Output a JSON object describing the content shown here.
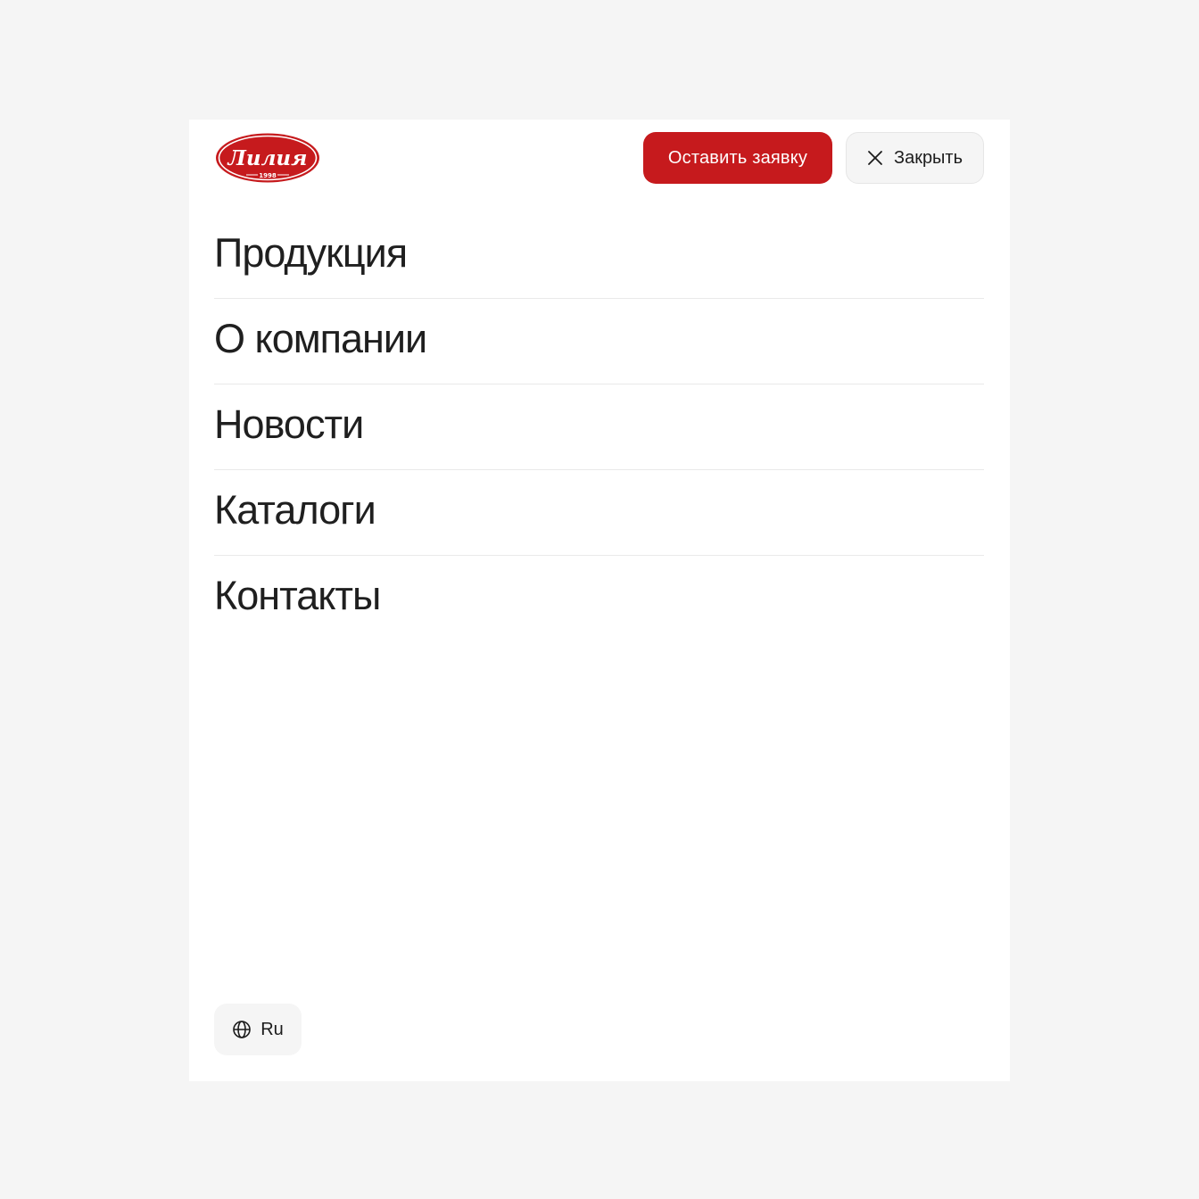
{
  "brand": {
    "logo_text": "Лилия",
    "logo_year": "1998",
    "accent_color": "#c61a1d"
  },
  "header": {
    "request_button_label": "Оставить заявку",
    "close_button_label": "Закрыть",
    "close_icon": "close-icon"
  },
  "nav": {
    "items": [
      {
        "label": "Продукция"
      },
      {
        "label": "О компании"
      },
      {
        "label": "Новости"
      },
      {
        "label": "Каталоги"
      },
      {
        "label": "Контакты"
      }
    ]
  },
  "language": {
    "label": "Ru",
    "icon": "globe-icon"
  }
}
